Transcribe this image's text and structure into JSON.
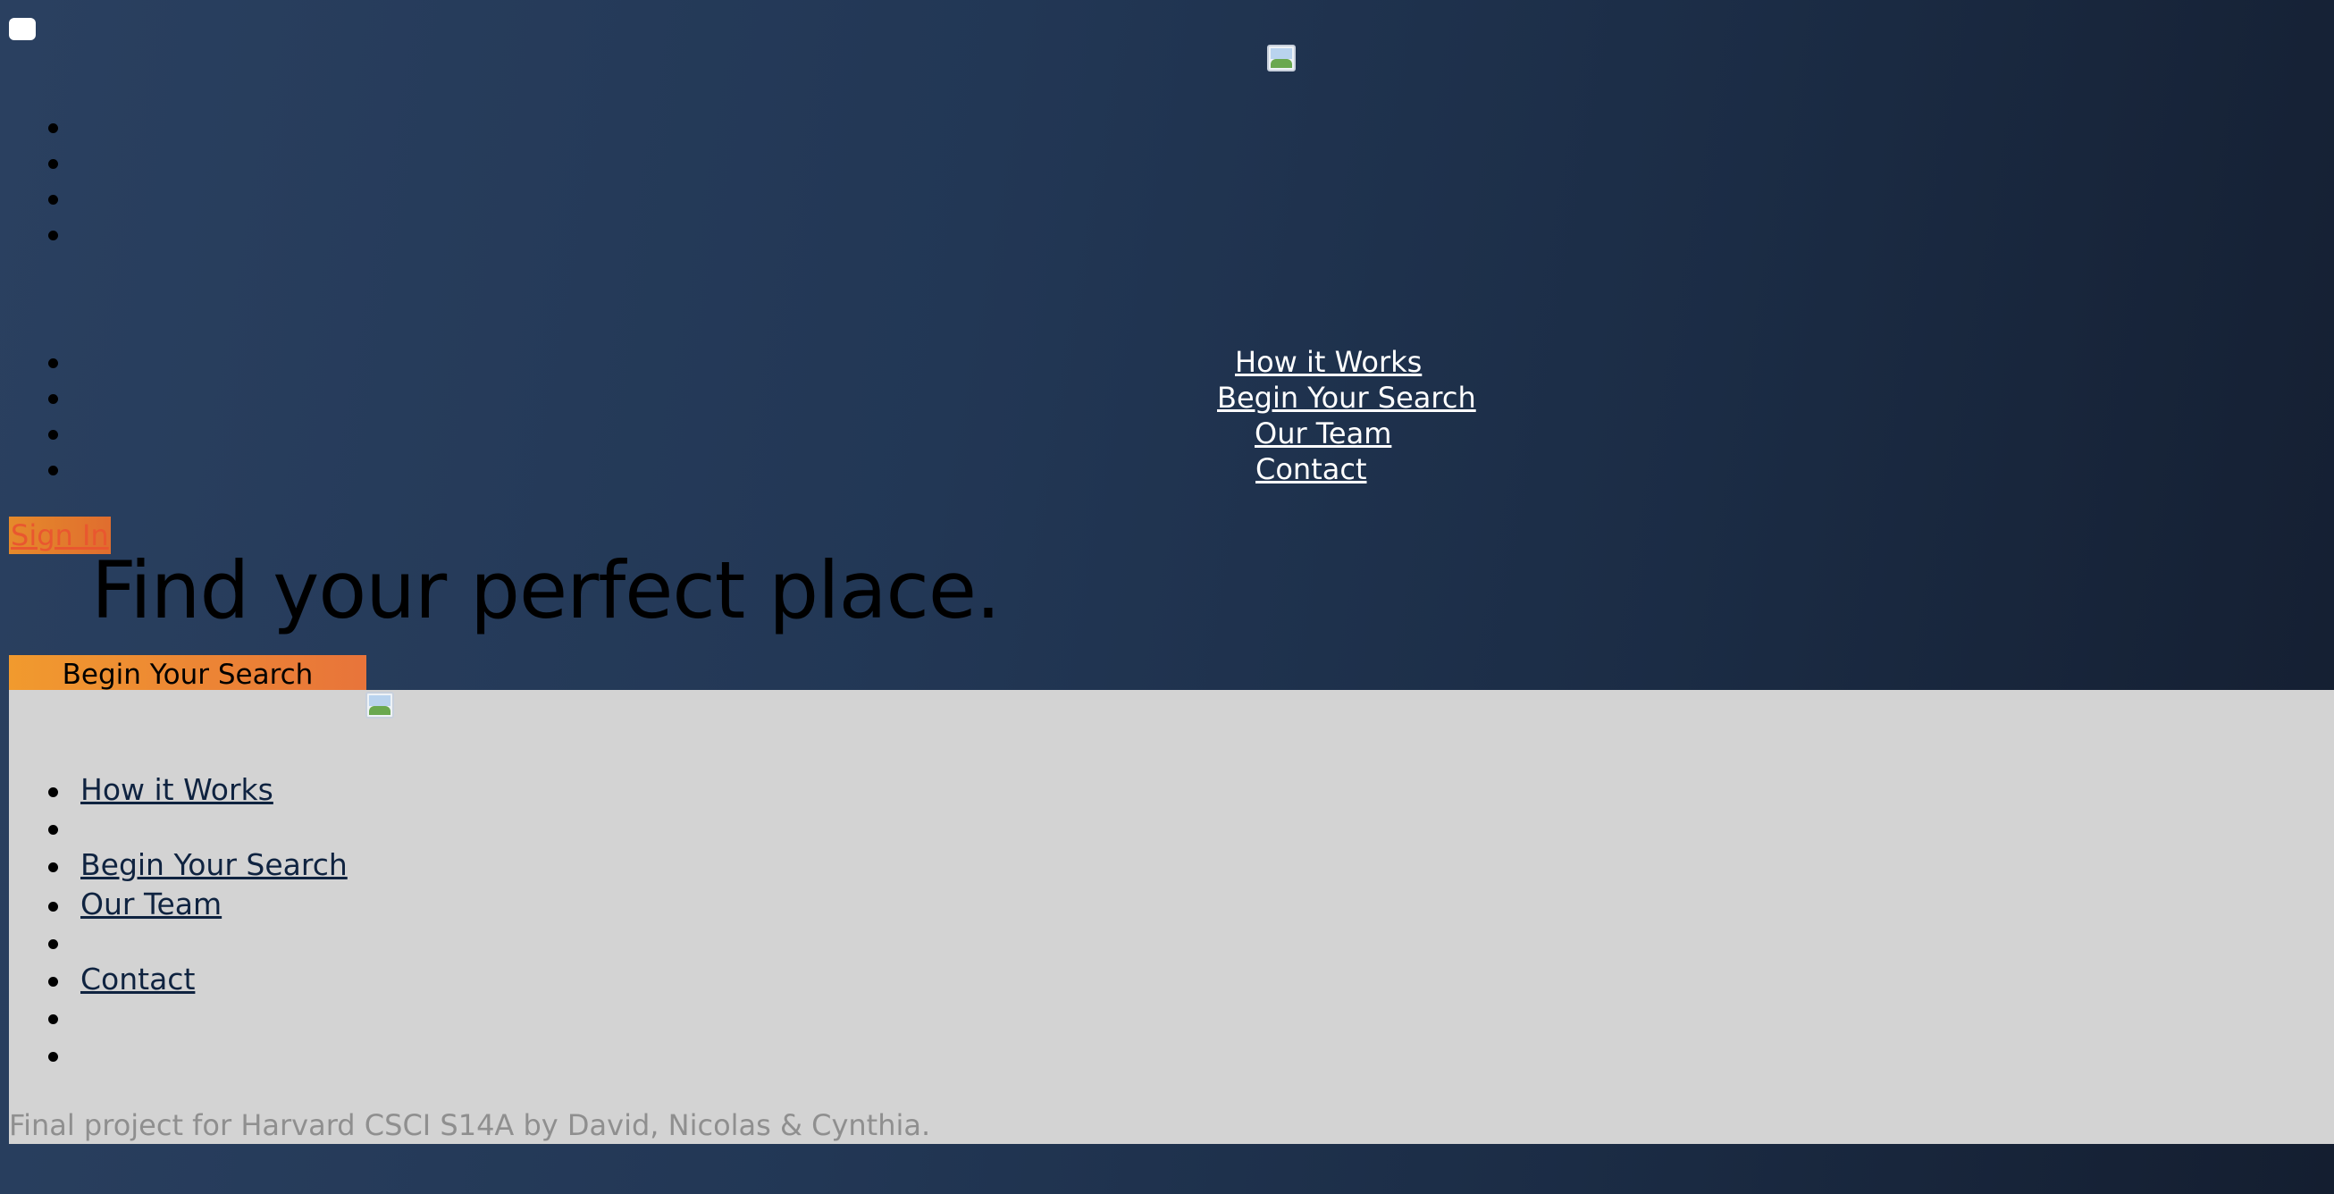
{
  "header": {
    "menu_toggle": "",
    "logo_alt": "",
    "nav": [
      {
        "label": "How it Works"
      },
      {
        "label": "Begin Your Search"
      },
      {
        "label": "Our Team"
      },
      {
        "label": "Contact"
      }
    ],
    "sign_in": "Sign In"
  },
  "hero": {
    "title": "Find your perfect place.",
    "cta": "Begin Your Search"
  },
  "footer": {
    "links": [
      {
        "label": "How it Works"
      },
      {
        "label": ""
      },
      {
        "label": "Begin Your Search"
      },
      {
        "label": "Our Team"
      },
      {
        "label": ""
      },
      {
        "label": "Contact"
      },
      {
        "label": ""
      },
      {
        "label": ""
      }
    ],
    "credit": "Final project for Harvard CSCI S14A by David, Nicolas & Cynthia."
  },
  "colors": {
    "bg_start": "#2a4060",
    "bg_end": "#141e30",
    "accent_orange": "#f19a2e",
    "footer_bg": "#d3d3d3",
    "footer_link": "#0f2340",
    "credit_text": "#8f8f8f"
  },
  "icons": {
    "menu": "menu-checkbox-icon",
    "logo": "broken-image-icon"
  }
}
